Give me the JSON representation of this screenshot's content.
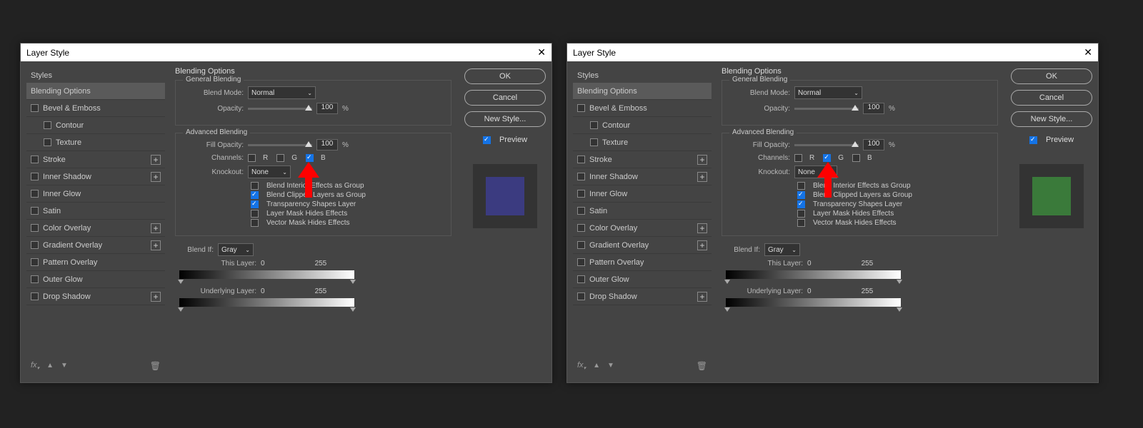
{
  "dialogs": [
    {
      "title": "Layer Style",
      "selected_style": "Blending Options",
      "preview_color": "#3b3b80",
      "channel_checked": "B",
      "arrow_target": "B"
    },
    {
      "title": "Layer Style",
      "selected_style": "Blending Options",
      "preview_color": "#3a7a3a",
      "channel_checked": "G",
      "arrow_target": "G"
    }
  ],
  "sidebar": {
    "header": "Styles",
    "items": [
      {
        "label": "Blending Options",
        "cb": null,
        "plus": false,
        "selected": true
      },
      {
        "label": "Bevel & Emboss",
        "cb": false,
        "plus": false
      },
      {
        "label": "Contour",
        "cb": false,
        "plus": false,
        "indent": true
      },
      {
        "label": "Texture",
        "cb": false,
        "plus": false,
        "indent": true
      },
      {
        "label": "Stroke",
        "cb": false,
        "plus": true
      },
      {
        "label": "Inner Shadow",
        "cb": false,
        "plus": true
      },
      {
        "label": "Inner Glow",
        "cb": false,
        "plus": false
      },
      {
        "label": "Satin",
        "cb": false,
        "plus": false
      },
      {
        "label": "Color Overlay",
        "cb": false,
        "plus": true
      },
      {
        "label": "Gradient Overlay",
        "cb": false,
        "plus": true
      },
      {
        "label": "Pattern Overlay",
        "cb": false,
        "plus": false
      },
      {
        "label": "Outer Glow",
        "cb": false,
        "plus": false
      },
      {
        "label": "Drop Shadow",
        "cb": false,
        "plus": true
      }
    ]
  },
  "main": {
    "title": "Blending Options",
    "general": {
      "legend": "General Blending",
      "blend_mode_label": "Blend Mode:",
      "blend_mode_value": "Normal",
      "opacity_label": "Opacity:",
      "opacity_value": "100",
      "pct": "%"
    },
    "advanced": {
      "legend": "Advanced Blending",
      "fill_opacity_label": "Fill Opacity:",
      "fill_opacity_value": "100",
      "pct": "%",
      "channels_label": "Channels:",
      "channels": [
        "R",
        "G",
        "B"
      ],
      "knockout_label": "Knockout:",
      "knockout_value": "None",
      "options": [
        {
          "label": "Blend Interior Effects as Group",
          "checked": false
        },
        {
          "label": "Blend Clipped Layers as Group",
          "checked": true
        },
        {
          "label": "Transparency Shapes Layer",
          "checked": true
        },
        {
          "label": "Layer Mask Hides Effects",
          "checked": false
        },
        {
          "label": "Vector Mask Hides Effects",
          "checked": false
        }
      ]
    },
    "blendif": {
      "label": "Blend If:",
      "value": "Gray",
      "this_layer_label": "This Layer:",
      "this_low": "0",
      "this_high": "255",
      "underlying_label": "Underlying Layer:",
      "under_low": "0",
      "under_high": "255"
    }
  },
  "buttons": {
    "ok": "OK",
    "cancel": "Cancel",
    "new_style": "New Style...",
    "preview": "Preview"
  },
  "footer": {
    "fx": "fx",
    "up": "▲",
    "down": "▼",
    "trash": "🗑"
  }
}
